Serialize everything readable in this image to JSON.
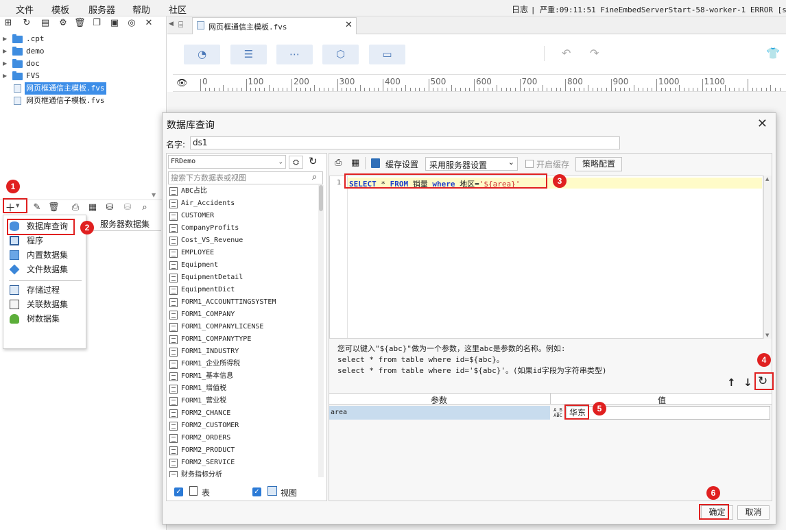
{
  "menubar": {
    "items": [
      "文件",
      "模板",
      "服务器",
      "帮助",
      "社区"
    ],
    "log_label": "日志",
    "log_message": "| 严重:09:11:51 FineEmbedServerStart-58-worker-1 ERROR [standa"
  },
  "file_tree": {
    "items": [
      {
        "label": ".cpt",
        "type": "folder"
      },
      {
        "label": "demo",
        "type": "folder"
      },
      {
        "label": "doc",
        "type": "folder"
      },
      {
        "label": "FVS",
        "type": "folder"
      },
      {
        "label": "网页框通信主模板.fvs",
        "type": "file",
        "selected": true
      },
      {
        "label": "网页框通信子模板.fvs",
        "type": "file"
      }
    ]
  },
  "dataset_panel": {
    "server_dataset_label": "服务器数据集"
  },
  "popup_menu": {
    "items": [
      "数据库查询",
      "程序",
      "内置数据集",
      "文件数据集",
      "存储过程",
      "关联数据集",
      "树数据集"
    ]
  },
  "editor": {
    "tab_title": "网页框通信主模板.fvs"
  },
  "ruler": {
    "labels": [
      "0",
      "100",
      "200",
      "300",
      "400",
      "500",
      "600",
      "700",
      "800",
      "900",
      "1000",
      "1100"
    ]
  },
  "dialog": {
    "title": "数据库查询",
    "name_label": "名字:",
    "name_value": "ds1",
    "connection": "FRDemo",
    "search_placeholder": "搜索下方数据表或视图",
    "tables": [
      "ABC占比",
      "Air_Accidents",
      "CUSTOMER",
      "CompanyProfits",
      "Cost_VS_Revenue",
      "EMPLOYEE",
      "Equipment",
      "EquipmentDetail",
      "EquipmentDict",
      "FORM1_ACCOUNTTINGSYSTEM",
      "FORM1_COMPANY",
      "FORM1_COMPANYLICENSE",
      "FORM1_COMPANYTYPE",
      "FORM1_INDUSTRY",
      "FORM1_企业所得税",
      "FORM1_基本信息",
      "FORM1_增值税",
      "FORM1_营业税",
      "FORM2_CHANCE",
      "FORM2_CUSTOMER",
      "FORM2_ORDERS",
      "FORM2_PRODUCT",
      "FORM2_SERVICE",
      "财务指标分析"
    ],
    "filter_table_label": "表",
    "filter_view_label": "视图",
    "cache_label": "缓存设置",
    "cache_option": "采用服务器设置",
    "enable_cache_label": "开启缓存",
    "strategy_button": "策略配置",
    "sql": {
      "line_no": "1",
      "select_kw": "SELECT",
      "star": " * ",
      "from_kw": "FROM",
      "table": " 销量 ",
      "where_kw": "where",
      "cond": " 地区=",
      "param": "'${area}'"
    },
    "hint_lines": [
      "您可以键入\"${abc}\"做为一个参数，这里abc是参数的名称。例如:",
      "select * from table where id=${abc}。",
      "select * from table where id='${abc}'。(如果id字段为字符串类型)"
    ],
    "param_header": "参数",
    "value_header": "值",
    "param_name": "area",
    "param_value": "华东",
    "ok_button": "确定",
    "cancel_button": "取消"
  },
  "annotations": [
    "1",
    "2",
    "3",
    "4",
    "5",
    "6"
  ],
  "colors": {
    "annotation": "#e02020",
    "selection": "#3d8ee8",
    "keyword": "#1f3ec8"
  }
}
